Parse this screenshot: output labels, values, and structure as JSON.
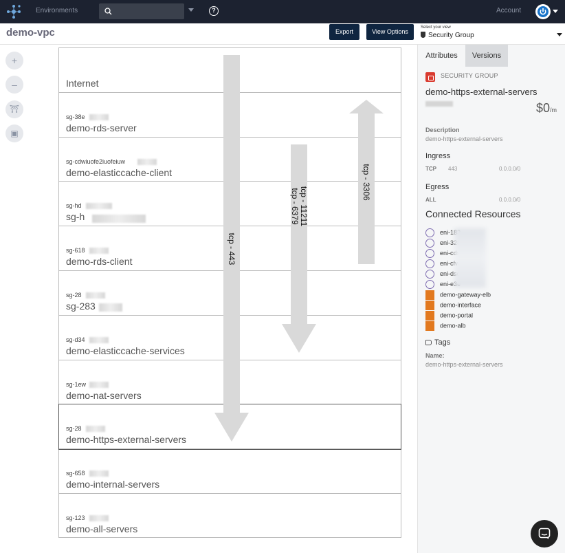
{
  "topbar": {
    "environments_label": "Environments",
    "account_label": "Account",
    "help_icon": "question-circle-icon",
    "search_placeholder": ""
  },
  "header": {
    "title": "demo-vpc",
    "export_label": "Export",
    "view_options_label": "View Options",
    "select_view_label": "Select your view",
    "select_view_value": "Security Group"
  },
  "tools": [
    {
      "name": "zoom-in",
      "glyph": "+"
    },
    {
      "name": "zoom-out",
      "glyph": "–"
    },
    {
      "name": "layout",
      "glyph": "⛩"
    },
    {
      "name": "fit",
      "glyph": "▣"
    }
  ],
  "diagram": {
    "rows": [
      {
        "id": "",
        "name": "Internet"
      },
      {
        "id": "sg-38e",
        "name": "demo-rds-server"
      },
      {
        "id": "sg-cdwiuofe2iuofeiuw",
        "name": "demo-elasticcache-client"
      },
      {
        "id": "sg-hd",
        "name": "sg-h"
      },
      {
        "id": "sg-618",
        "name": "demo-rds-client"
      },
      {
        "id": "sg-28",
        "name": "sg-283"
      },
      {
        "id": "sg-d34",
        "name": "demo-elasticcache-services"
      },
      {
        "id": "sg-1ew",
        "name": "demo-nat-servers"
      },
      {
        "id": "sg-28",
        "name": "demo-https-external-servers"
      },
      {
        "id": "sg-658",
        "name": "demo-internal-servers"
      },
      {
        "id": "sg-123",
        "name": "demo-all-servers"
      }
    ],
    "selected_row": 8,
    "flows": [
      {
        "label": "tcp - 443",
        "direction": "down"
      },
      {
        "label": "tcp - 11211",
        "direction": "down"
      },
      {
        "label": "tcp - 6379",
        "direction": "down"
      },
      {
        "label": "tcp - 3306",
        "direction": "up"
      }
    ]
  },
  "panel": {
    "tabs": [
      "Attributes",
      "Versions"
    ],
    "type_label": "SECURITY GROUP",
    "name": "demo-https-external-servers",
    "cost": "$0",
    "cost_unit": "/m",
    "description_label": "Description",
    "description_value": "demo-https-external-servers",
    "ingress_label": "Ingress",
    "ingress_rules": [
      {
        "proto": "TCP",
        "port": "443",
        "cidr": "0.0.0.0/0"
      }
    ],
    "egress_label": "Egress",
    "egress_rules": [
      {
        "proto": "ALL",
        "port": "",
        "cidr": "0.0.0.0/0"
      }
    ],
    "connected_label": "Connected Resources",
    "resources": [
      {
        "type": "eni",
        "name": "eni-183"
      },
      {
        "type": "eni",
        "name": "eni-328"
      },
      {
        "type": "eni",
        "name": "eni-cds"
      },
      {
        "type": "eni",
        "name": "eni-cfw"
      },
      {
        "type": "eni",
        "name": "eni-dsc"
      },
      {
        "type": "eni",
        "name": "eni-e3e"
      },
      {
        "type": "elb",
        "name": "demo-gateway-elb"
      },
      {
        "type": "elb",
        "name": "demo-interface"
      },
      {
        "type": "elb",
        "name": "demo-portal"
      },
      {
        "type": "elb",
        "name": "demo-alb"
      }
    ],
    "tags_label": "Tags",
    "tag_name_label": "Name:",
    "tag_name_value": "demo-https-external-servers"
  },
  "colors": {
    "topbar": "#1c2230",
    "button": "#0f2540",
    "security_group_badge": "#d93b30",
    "eni_icon": "#7d6bb0",
    "elb_icon": "#e2791f",
    "flow_arrow": "#d9d9d9"
  }
}
